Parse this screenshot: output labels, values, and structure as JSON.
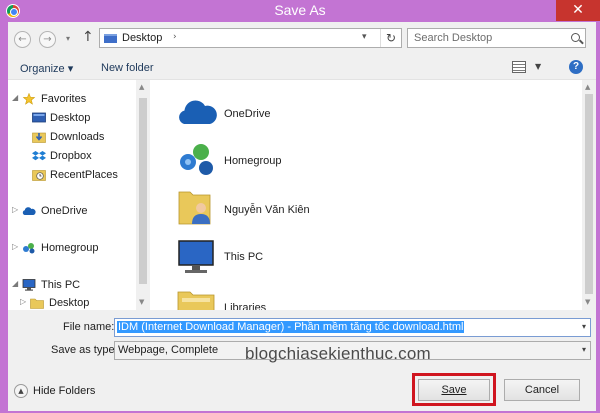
{
  "window": {
    "title": "Save As",
    "close_glyph": "✕"
  },
  "address_bar": {
    "back_glyph": "←",
    "forward_glyph": "→",
    "up_glyph": "↑",
    "path": "Desktop",
    "chevron": "›",
    "drop_glyph": "▾",
    "refresh_glyph": "↻"
  },
  "search": {
    "placeholder": "Search Desktop"
  },
  "toolbar": {
    "organize": "Organize ▾",
    "new_folder": "New folder",
    "view_drop": "▼",
    "help": "?"
  },
  "nav_pane": {
    "items": [
      {
        "label": "Favorites",
        "expander": "◢",
        "icon": "star-icon"
      },
      {
        "label": "Desktop",
        "icon": "desktop-icon"
      },
      {
        "label": "Downloads",
        "icon": "downloads-icon"
      },
      {
        "label": "Dropbox",
        "icon": "dropbox-icon"
      },
      {
        "label": "RecentPlaces",
        "icon": "recent-places-icon"
      },
      {
        "label": "OneDrive",
        "expander": "▷",
        "icon": "onedrive-icon"
      },
      {
        "label": "Homegroup",
        "expander": "▷",
        "icon": "homegroup-icon"
      },
      {
        "label": "This PC",
        "expander": "◢",
        "icon": "computer-icon"
      },
      {
        "label": "Desktop",
        "expander": "▷",
        "icon": "folder-icon"
      }
    ],
    "scroll_up": "▲",
    "scroll_down": "▼"
  },
  "file_list": {
    "items": [
      {
        "label": "OneDrive",
        "icon": "onedrive-icon"
      },
      {
        "label": "Homegroup",
        "icon": "homegroup-icon"
      },
      {
        "label": "Nguyễn Văn Kiên",
        "icon": "user-folder-icon"
      },
      {
        "label": "This PC",
        "icon": "computer-icon"
      },
      {
        "label": "Libraries",
        "icon": "libraries-icon"
      }
    ],
    "scroll_up": "▲",
    "scroll_down": "▼"
  },
  "form": {
    "file_name_label": "File name:",
    "file_name_value": "IDM (Internet Download Manager) - Phần mềm tăng tốc download.html",
    "save_type_label": "Save as type:",
    "save_type_value": "Webpage, Complete",
    "drop_glyph": "▾"
  },
  "watermark": "blogchiasekienthuc.com",
  "footer": {
    "hide_folders": "Hide Folders",
    "hide_folders_glyph": "▲",
    "save": "Save",
    "cancel": "Cancel"
  },
  "colors": {
    "title_bar": "#c374d3",
    "close_button": "#c7342e",
    "selection": "#3399ff",
    "highlight_box": "#d0151f"
  }
}
